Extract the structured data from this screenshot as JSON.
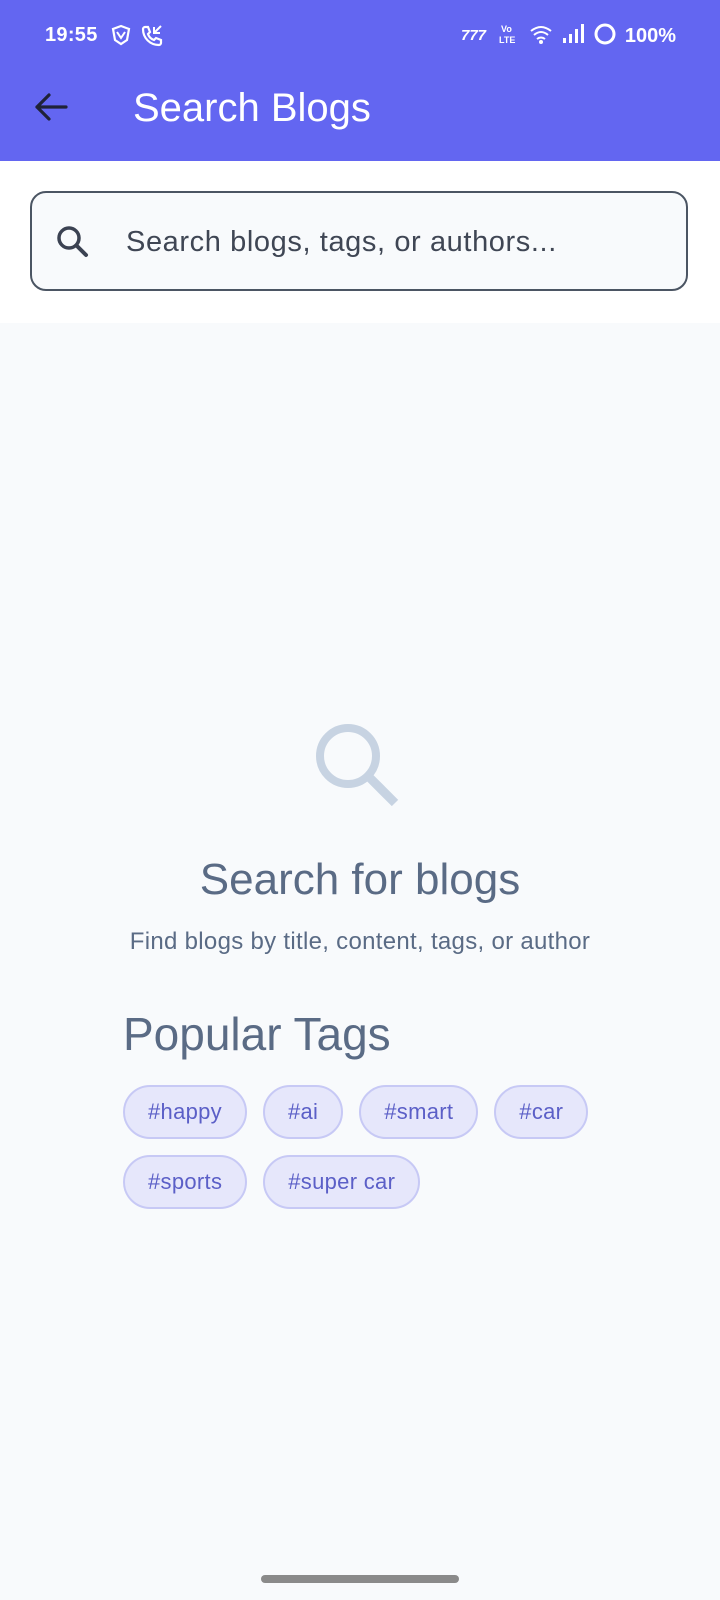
{
  "status_bar": {
    "time": "19:55",
    "battery": "100%",
    "icons": [
      "vpn-shield-icon",
      "call-icon",
      "jio-icon",
      "volte-icon",
      "wifi-icon",
      "signal-icon",
      "battery-ring-icon"
    ]
  },
  "app_bar": {
    "title": "Search Blogs",
    "back_icon": "arrow-left-icon"
  },
  "search": {
    "placeholder": "Search blogs, tags, or authors...",
    "value": ""
  },
  "empty_state": {
    "icon": "search-icon",
    "title": "Search for blogs",
    "subtitle": "Find blogs by title, content, tags, or author"
  },
  "popular_tags": {
    "heading": "Popular Tags",
    "tags": [
      "#happy",
      "#ai",
      "#smart",
      "#car",
      "#sports",
      "#super car"
    ]
  },
  "colors": {
    "primary": "#6366f1",
    "background": "#f8fafc",
    "muted_text": "#5a6b85",
    "tag_bg": "#e6e7fb",
    "tag_text": "#5b5fc7"
  }
}
